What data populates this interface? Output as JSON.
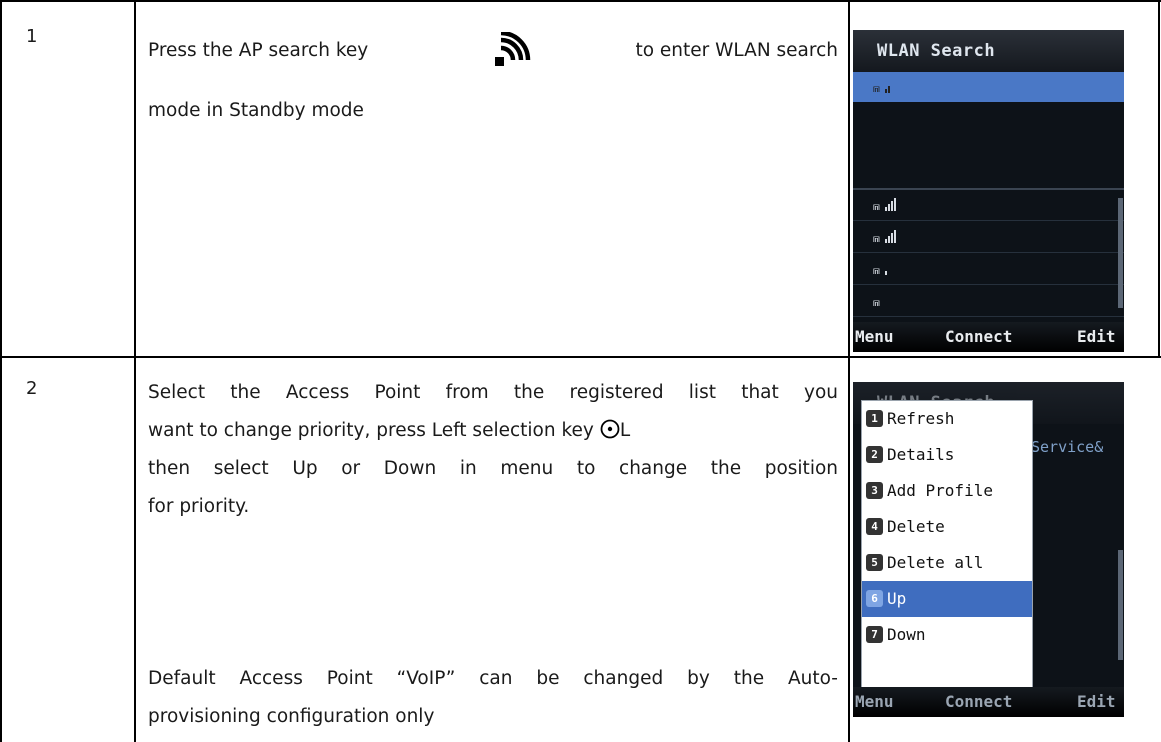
{
  "steps": [
    {
      "number": "1",
      "text_line1": "Press the AP search key",
      "text_line1_end": "to enter WLAN search",
      "text_line2": "mode in Standby mode",
      "key_icon": "wifi-signal-icon"
    },
    {
      "number": "2",
      "lines": [
        "Select the Access Point from the registered list that you",
        "want to change priority, press Left selection key",
        "then select Up or Down in menu to change the position",
        "for priority."
      ],
      "left_key_suffix": "L",
      "note_lines": [
        "Default Access Point “VoIP” can be changed by the Auto-",
        "provisioning configuration only"
      ]
    }
  ],
  "screen1": {
    "title": "WLAN Search",
    "softkeys": {
      "left": "Menu",
      "center": "Connect",
      "right": "Edit"
    }
  },
  "screen2": {
    "title_partial": "WLAN Search",
    "bg_text": "Service&",
    "menu_items": [
      {
        "num": "1",
        "label": "Refresh"
      },
      {
        "num": "2",
        "label": "Details"
      },
      {
        "num": "3",
        "label": "Add Profile"
      },
      {
        "num": "4",
        "label": "Delete"
      },
      {
        "num": "5",
        "label": "Delete all"
      },
      {
        "num": "6",
        "label": "Up"
      },
      {
        "num": "7",
        "label": "Down"
      }
    ],
    "selected_item": "Up",
    "softkeys": {
      "left": "Menu",
      "center": "Connect",
      "right": "Edit"
    }
  },
  "colors": {
    "selection": "#4a78c6",
    "screen_bg": "#0d1218"
  }
}
